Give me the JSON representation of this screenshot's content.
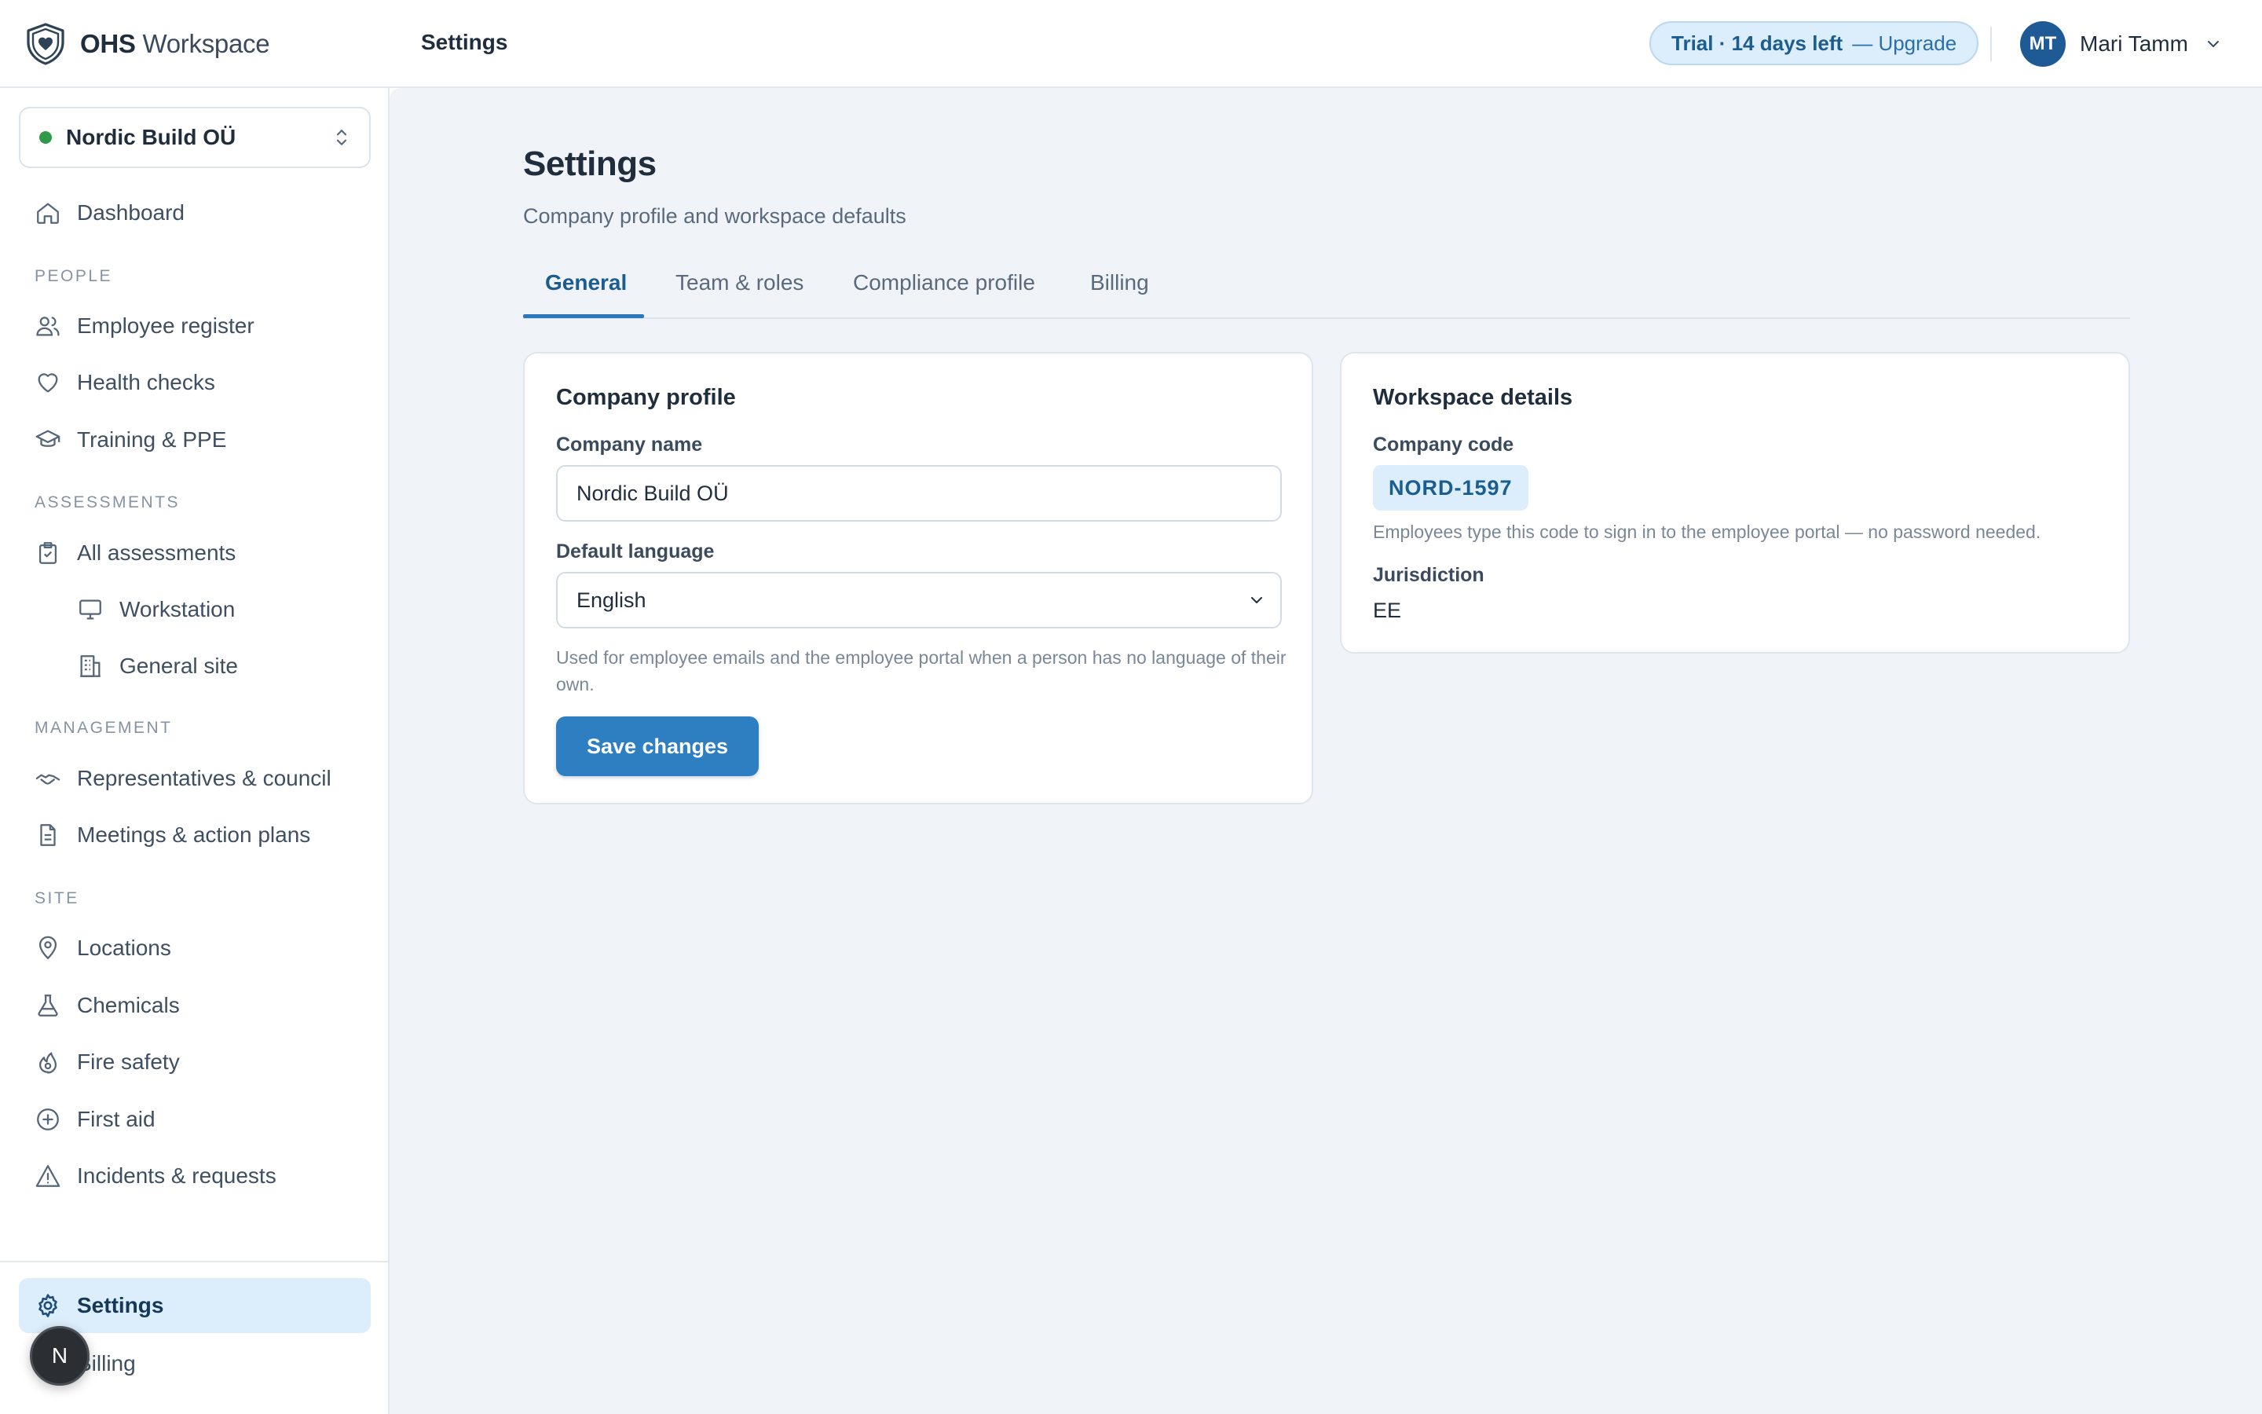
{
  "brand": {
    "bold": "OHS",
    "light": "Workspace"
  },
  "topbar": {
    "page_title": "Settings",
    "trial_text": "Trial · 14 days left",
    "upgrade_text": "— Upgrade",
    "user_initials": "MT",
    "user_name": "Mari Tamm"
  },
  "sidebar": {
    "org_name": "Nordic Build OÜ",
    "dashboard": "Dashboard",
    "sections": {
      "people": "PEOPLE",
      "assessments": "ASSESSMENTS",
      "management": "MANAGEMENT",
      "site": "SITE"
    },
    "items": {
      "employee_register": "Employee register",
      "health_checks": "Health checks",
      "training_ppe": "Training & PPE",
      "all_assessments": "All assessments",
      "workstation": "Workstation",
      "general_site": "General site",
      "representatives": "Representatives & council",
      "meetings": "Meetings & action plans",
      "locations": "Locations",
      "chemicals": "Chemicals",
      "fire_safety": "Fire safety",
      "first_aid": "First aid",
      "incidents": "Incidents & requests",
      "settings": "Settings",
      "billing": "Billing"
    },
    "fab_initial": "N"
  },
  "main": {
    "title": "Settings",
    "subtitle": "Company profile and workspace defaults",
    "tabs": [
      "General",
      "Team & roles",
      "Compliance profile",
      "Billing"
    ],
    "company_profile": {
      "title": "Company profile",
      "company_name_label": "Company name",
      "company_name_value": "Nordic Build OÜ",
      "language_label": "Default language",
      "language_value": "English",
      "language_help": "Used for employee emails and the employee portal when a person has no language of their own.",
      "save_label": "Save changes"
    },
    "workspace_details": {
      "title": "Workspace details",
      "code_label": "Company code",
      "code_value": "NORD-1597",
      "code_help": "Employees type this code to sign in to the employee portal — no password needed.",
      "jurisdiction_label": "Jurisdiction",
      "jurisdiction_value": "EE"
    }
  },
  "colors": {
    "accent": "#2e7ec2",
    "accent_light": "#dcedfb",
    "org_status": "#2f9a47",
    "background": "#f0f4f9"
  },
  "icons": [
    "shield-heart-icon",
    "chevron-down-icon",
    "chevron-updown-icon",
    "home-icon",
    "users-icon",
    "heart-icon",
    "graduation-cap-icon",
    "clipboard-icon",
    "monitor-icon",
    "building-icon",
    "handshake-icon",
    "document-icon",
    "map-pin-icon",
    "flask-icon",
    "flame-icon",
    "plus-circle-icon",
    "alert-triangle-icon",
    "gear-icon"
  ]
}
